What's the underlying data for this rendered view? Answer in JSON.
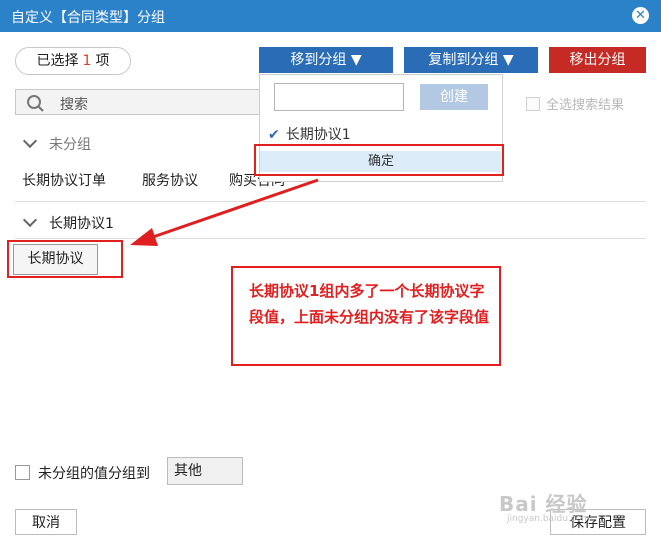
{
  "dialog": {
    "title": "自定义【合同类型】分组",
    "close_icon": "close-icon"
  },
  "toolbar": {
    "selected_prefix": "已选择",
    "selected_count": "1",
    "selected_suffix": "项",
    "move_to_group": "移到分组 ▼",
    "copy_to_group": "复制到分组 ▼",
    "remove_from_group": "移出分组"
  },
  "search": {
    "placeholder": "搜索",
    "select_all_label": "全选搜索结果"
  },
  "groups": {
    "ungrouped": {
      "title": "未分组",
      "items": [
        "长期协议订单",
        "服务协议",
        "购买合同"
      ]
    },
    "group1": {
      "title": "长期协议1",
      "items": [
        "长期协议"
      ]
    }
  },
  "dropdown": {
    "input_value": "",
    "create_label": "创建",
    "option_label": "长期协议1",
    "confirm_label": "确定"
  },
  "annotation": {
    "text": "长期协议1组内多了一个长期协议字段值，上面未分组内没有了该字段值"
  },
  "footer": {
    "ungrouped_checkbox_label": "未分组的值分组到",
    "other_value": "其他",
    "cancel_label": "取消",
    "save_label": "保存配置"
  },
  "watermark": {
    "text": "Bai 经验",
    "sub": "jingyan.baidu.com"
  },
  "colors": {
    "title_bar": "#2c82c9",
    "primary_button": "#2a6cb5",
    "danger_button": "#c52b24",
    "annotation_red": "#e02020"
  }
}
